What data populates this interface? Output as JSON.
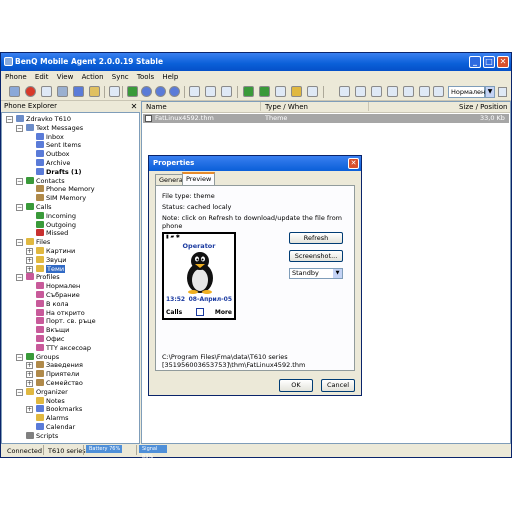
{
  "window": {
    "title": "BenQ Mobile Agent 2.0.0.19 Stable",
    "menu": [
      "Phone",
      "Edit",
      "View",
      "Action",
      "Sync",
      "Tools",
      "Help"
    ],
    "profile_select": "Нормален"
  },
  "explorer": {
    "title": "Phone Explorer",
    "close": "✕",
    "tree": [
      {
        "label": "Zdravko T610",
        "icon": "phone-icon",
        "color": "#6b8cc8"
      },
      {
        "label": "Text Messages",
        "icon": "messages-icon",
        "color": "#6b8cc8"
      },
      {
        "label": "Inbox",
        "icon": "inbox-icon",
        "color": "#5a7bd8"
      },
      {
        "label": "Sent Items",
        "icon": "sent-icon",
        "color": "#5a7bd8"
      },
      {
        "label": "Outbox",
        "icon": "outbox-icon",
        "color": "#5a7bd8"
      },
      {
        "label": "Archive",
        "icon": "archive-icon",
        "color": "#5a7bd8"
      },
      {
        "label": "Drafts (1)",
        "icon": "drafts-icon",
        "color": "#5a7bd8",
        "bold": true
      },
      {
        "label": "Contacts",
        "icon": "contacts-icon",
        "color": "#3a9a3a"
      },
      {
        "label": "Phone Memory",
        "icon": "phone-memory-icon",
        "color": "#b08a4a"
      },
      {
        "label": "SIM Memory",
        "icon": "sim-memory-icon",
        "color": "#b08a4a"
      },
      {
        "label": "Calls",
        "icon": "calls-icon",
        "color": "#3a9a3a"
      },
      {
        "label": "Incoming",
        "icon": "incoming-call-icon",
        "color": "#3a9a3a"
      },
      {
        "label": "Outgoing",
        "icon": "outgoing-call-icon",
        "color": "#3a9a3a"
      },
      {
        "label": "Missed",
        "icon": "missed-call-icon",
        "color": "#c83030"
      },
      {
        "label": "Files",
        "icon": "files-icon",
        "color": "#e0b840"
      },
      {
        "label": "Картини",
        "icon": "folder-icon",
        "color": "#e0b840"
      },
      {
        "label": "Звуци",
        "icon": "folder-icon",
        "color": "#e0b840"
      },
      {
        "label": "Теми",
        "icon": "folder-icon",
        "color": "#e0b840",
        "selected": true
      },
      {
        "label": "Profiles",
        "icon": "profiles-icon",
        "color": "#c85a9a"
      },
      {
        "label": "Нормален",
        "icon": "profile-icon",
        "color": "#c85a9a"
      },
      {
        "label": "Събрание",
        "icon": "profile-icon",
        "color": "#c85a9a"
      },
      {
        "label": "В кола",
        "icon": "profile-icon",
        "color": "#c85a9a"
      },
      {
        "label": "На открито",
        "icon": "profile-icon",
        "color": "#c85a9a"
      },
      {
        "label": "Порт. св. ръце",
        "icon": "profile-icon",
        "color": "#c85a9a"
      },
      {
        "label": "Вкъщи",
        "icon": "profile-icon",
        "color": "#c85a9a"
      },
      {
        "label": "Офис",
        "icon": "profile-icon",
        "color": "#c85a9a"
      },
      {
        "label": "TTY аксесоар",
        "icon": "profile-icon",
        "color": "#c85a9a"
      },
      {
        "label": "Groups",
        "icon": "groups-icon",
        "color": "#3a9a3a"
      },
      {
        "label": "Заведения",
        "icon": "group-icon",
        "color": "#b08a4a"
      },
      {
        "label": "Приятели",
        "icon": "group-icon",
        "color": "#b08a4a"
      },
      {
        "label": "Семейство",
        "icon": "group-icon",
        "color": "#b08a4a"
      },
      {
        "label": "Organizer",
        "icon": "organizer-icon",
        "color": "#e0b840"
      },
      {
        "label": "Notes",
        "icon": "notes-icon",
        "color": "#e0b840"
      },
      {
        "label": "Bookmarks",
        "icon": "bookmarks-icon",
        "color": "#5a7bd8"
      },
      {
        "label": "Alarms",
        "icon": "alarms-icon",
        "color": "#e0b840"
      },
      {
        "label": "Calendar",
        "icon": "calendar-icon",
        "color": "#5a7bd8"
      },
      {
        "label": "Scripts",
        "icon": "scripts-icon",
        "color": "#808080"
      }
    ]
  },
  "list": {
    "columns": [
      "Name",
      "Type / When",
      "Size / Position"
    ],
    "rows": [
      {
        "name": "FatLinux4592.thm",
        "type": "Theme",
        "size": "33,0 Kb"
      }
    ]
  },
  "statusbar": {
    "status": "Connected",
    "device": "T610 series",
    "battery": "Battery 76%",
    "signal": "Signal 83%"
  },
  "dialog": {
    "title": "Properties",
    "close": "✕",
    "tabs": [
      "General",
      "Preview"
    ],
    "file_type": "File type:  theme",
    "status": "Status:  cached localy",
    "note": "Note: click on Refresh to download/update the file from phone",
    "phone": {
      "operator": "Operator",
      "time": "13:52",
      "date": "08-Април-05",
      "left_soft": "Calls",
      "right_soft": "More"
    },
    "refresh": "Refresh",
    "screenshot": "Screenshot...",
    "mode": "Standby",
    "path_line1": "C:\\Program Files\\Fma\\data\\T610 series",
    "path_line2": "[351956003653753]\\thm\\FatLinux4592.thm",
    "ok": "OK",
    "cancel": "Cancel"
  }
}
